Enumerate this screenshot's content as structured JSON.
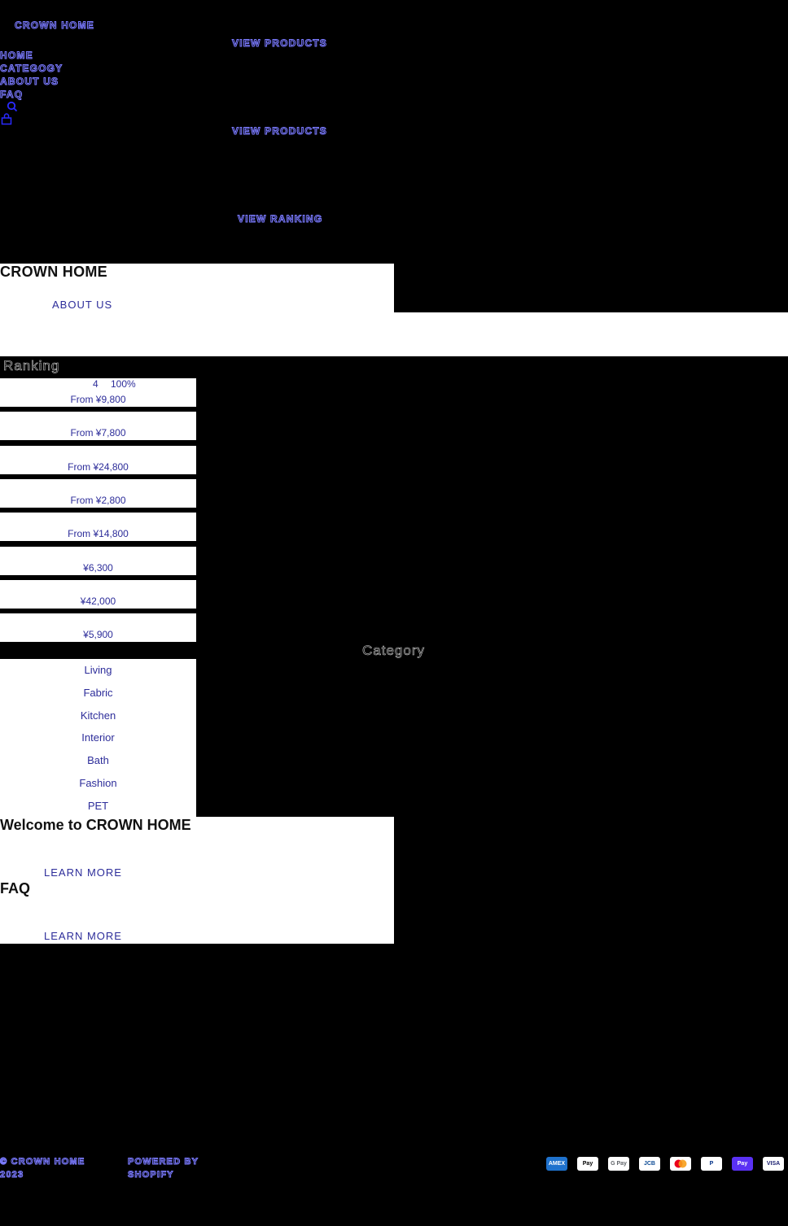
{
  "header": {
    "logo": "CROWN HOME",
    "nav": [
      "HOME",
      "CATEGOGY",
      "ABOUT US",
      "FAQ"
    ],
    "icons": [
      "search-icon",
      "cart-icon"
    ]
  },
  "hero": {
    "buttons": [
      "VIEW PRODUCTS",
      "VIEW PRODUCTS",
      "VIEW RANKING"
    ]
  },
  "about": {
    "title": "CROWN HOME",
    "link": "ABOUT US"
  },
  "ranking": {
    "title": "Ranking",
    "badge": "4 100%",
    "items": [
      {
        "price": "From ¥9,800"
      },
      {
        "price": "From ¥7,800"
      },
      {
        "price": "From ¥24,800"
      },
      {
        "price": "From ¥2,800"
      },
      {
        "price": "From ¥14,800"
      },
      {
        "price": "¥6,300"
      },
      {
        "price": "¥42,000"
      },
      {
        "price": "¥5,900"
      }
    ]
  },
  "category": {
    "title": "Category",
    "items": [
      "Living",
      "Fabric",
      "Kitchen",
      "Interior",
      "Bath",
      "Fashion",
      "PET"
    ]
  },
  "welcome": {
    "title": "Welcome to CROWN HOME",
    "link": "LEARN MORE"
  },
  "faq": {
    "title": "FAQ",
    "link": "LEARN MORE"
  },
  "footer": {
    "copyright": "© CROWN HOME 2023",
    "powered": "POWERED BY SHOPIFY",
    "payments": [
      {
        "name": "amex",
        "label": "AMEX",
        "bg": "#1f72cd",
        "fg": "#ffffff"
      },
      {
        "name": "apple-pay",
        "label": "Pay",
        "bg": "#ffffff",
        "fg": "#000000"
      },
      {
        "name": "google-pay",
        "label": "G Pay",
        "bg": "#ffffff",
        "fg": "#5f6368"
      },
      {
        "name": "jcb",
        "label": "JCB",
        "bg": "#ffffff",
        "fg": "#0e4c96"
      },
      {
        "name": "mastercard",
        "label": "",
        "bg": "#ffffff",
        "fg": "#eb001b"
      },
      {
        "name": "paypal",
        "label": "P",
        "bg": "#ffffff",
        "fg": "#003087"
      },
      {
        "name": "shop-pay",
        "label": "Pay",
        "bg": "#5a31f4",
        "fg": "#ffffff"
      },
      {
        "name": "visa",
        "label": "VISA",
        "bg": "#ffffff",
        "fg": "#1a1f71"
      }
    ]
  }
}
